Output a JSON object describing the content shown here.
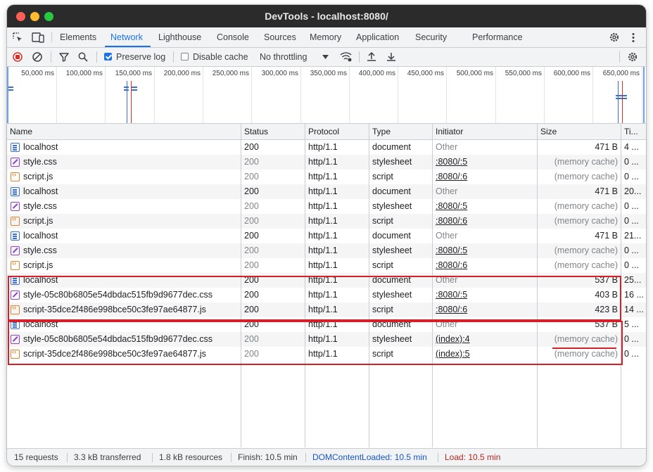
{
  "window": {
    "title": "DevTools - localhost:8080/"
  },
  "icons": {
    "inspect": "inspect-element-icon",
    "device": "device-toolbar-icon",
    "settings": "gear-icon",
    "more": "kebab-menu-icon"
  },
  "tabs": [
    {
      "label": "Elements"
    },
    {
      "label": "Network"
    },
    {
      "label": "Lighthouse"
    },
    {
      "label": "Console"
    },
    {
      "label": "Sources"
    },
    {
      "label": "Memory"
    },
    {
      "label": "Application"
    },
    {
      "label": "Security"
    },
    {
      "label": "Performance"
    }
  ],
  "toolbar": {
    "preserve_log": "Preserve log",
    "preserve_log_checked": true,
    "disable_cache": "Disable cache",
    "disable_cache_checked": false,
    "throttling": "No throttling"
  },
  "overview": {
    "ticks": [
      "50,000 ms",
      "100,000 ms",
      "150,000 ms",
      "200,000 ms",
      "250,000 ms",
      "300,000 ms",
      "350,000 ms",
      "400,000 ms",
      "450,000 ms",
      "500,000 ms",
      "550,000 ms",
      "600,000 ms",
      "650,000 ms"
    ]
  },
  "columns": [
    "Name",
    "Status",
    "Protocol",
    "Type",
    "Initiator",
    "Size",
    "Ti..."
  ],
  "rows": [
    {
      "name": "localhost",
      "kind": "doc",
      "status": "200",
      "protocol": "http/1.1",
      "type": "document",
      "initiator": "Other",
      "size": "471 B",
      "time": "4 ..."
    },
    {
      "name": "style.css",
      "kind": "css",
      "status": "200",
      "protocol": "http/1.1",
      "type": "stylesheet",
      "initiator": ":8080/:5",
      "size": "(memory cache)",
      "time": "0 ..."
    },
    {
      "name": "script.js",
      "kind": "js",
      "status": "200",
      "protocol": "http/1.1",
      "type": "script",
      "initiator": ":8080/:6",
      "size": "(memory cache)",
      "time": "0 ..."
    },
    {
      "name": "localhost",
      "kind": "doc",
      "status": "200",
      "protocol": "http/1.1",
      "type": "document",
      "initiator": "Other",
      "size": "471 B",
      "time": "20..."
    },
    {
      "name": "style.css",
      "kind": "css",
      "status": "200",
      "protocol": "http/1.1",
      "type": "stylesheet",
      "initiator": ":8080/:5",
      "size": "(memory cache)",
      "time": "0 ..."
    },
    {
      "name": "script.js",
      "kind": "js",
      "status": "200",
      "protocol": "http/1.1",
      "type": "script",
      "initiator": ":8080/:6",
      "size": "(memory cache)",
      "time": "0 ..."
    },
    {
      "name": "localhost",
      "kind": "doc",
      "status": "200",
      "protocol": "http/1.1",
      "type": "document",
      "initiator": "Other",
      "size": "471 B",
      "time": "21..."
    },
    {
      "name": "style.css",
      "kind": "css",
      "status": "200",
      "protocol": "http/1.1",
      "type": "stylesheet",
      "initiator": ":8080/:5",
      "size": "(memory cache)",
      "time": "0 ..."
    },
    {
      "name": "script.js",
      "kind": "js",
      "status": "200",
      "protocol": "http/1.1",
      "type": "script",
      "initiator": ":8080/:6",
      "size": "(memory cache)",
      "time": "0 ..."
    },
    {
      "name": "localhost",
      "kind": "doc",
      "status": "200",
      "protocol": "http/1.1",
      "type": "document",
      "initiator": "Other",
      "size": "537 B",
      "time": "25..."
    },
    {
      "name": "style-05c80b6805e54dbdac515fb9d9677dec.css",
      "kind": "css",
      "status": "200",
      "protocol": "http/1.1",
      "type": "stylesheet",
      "initiator": ":8080/:5",
      "size": "403 B",
      "time": "16 ..."
    },
    {
      "name": "script-35dce2f486e998bce50c3fe97ae64877.js",
      "kind": "js",
      "status": "200",
      "protocol": "http/1.1",
      "type": "script",
      "initiator": ":8080/:6",
      "size": "423 B",
      "time": "14 ..."
    },
    {
      "name": "localhost",
      "kind": "doc",
      "status": "200",
      "protocol": "http/1.1",
      "type": "document",
      "initiator": "Other",
      "size": "537 B",
      "time": "5 ..."
    },
    {
      "name": "style-05c80b6805e54dbdac515fb9d9677dec.css",
      "kind": "css",
      "status": "200",
      "protocol": "http/1.1",
      "type": "stylesheet",
      "initiator": "(index):4",
      "size": "(memory cache)",
      "time": "0 ..."
    },
    {
      "name": "script-35dce2f486e998bce50c3fe97ae64877.js",
      "kind": "js",
      "status": "200",
      "protocol": "http/1.1",
      "type": "script",
      "initiator": "(index):5",
      "size": "(memory cache)",
      "time": "0 ..."
    }
  ],
  "status": {
    "requests": "15 requests",
    "transferred": "3.3 kB transferred",
    "resources": "1.8 kB resources",
    "finish": "Finish: 10.5 min",
    "dom": "DOMContentLoaded: 10.5 min",
    "load": "Load: 10.5 min"
  },
  "colors": {
    "accent": "#1a73e8",
    "highlight": "#d61f26",
    "dom_loaded": "#1a55c6",
    "load": "#b3261e"
  }
}
